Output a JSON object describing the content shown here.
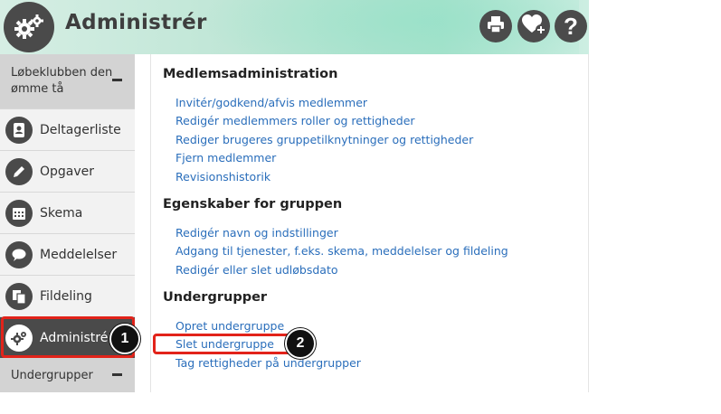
{
  "header": {
    "title": "Administrér",
    "logo_icon": "gears-icon",
    "actions": [
      {
        "icon": "printer-icon"
      },
      {
        "icon": "heart-plus-icon"
      },
      {
        "icon": "help-icon",
        "label": "?"
      }
    ]
  },
  "sidebar": {
    "group_name": "Løbeklubben den\nømme tå",
    "items": [
      {
        "label": "Deltagerliste",
        "icon": "contacts-book-icon"
      },
      {
        "label": "Opgaver",
        "icon": "pencil-icon"
      },
      {
        "label": "Skema",
        "icon": "calendar-icon"
      },
      {
        "label": "Meddelelser",
        "icon": "chat-bubble-icon"
      },
      {
        "label": "Fildeling",
        "icon": "documents-icon"
      },
      {
        "label": "Administrér",
        "icon": "gears-icon",
        "active": true
      }
    ],
    "subgroups_label": "Undergrupper"
  },
  "main": {
    "sections": [
      {
        "title": "Medlemsadministration",
        "links": [
          "Invitér/godkend/afvis medlemmer",
          "Redigér medlemmers roller og rettigheder",
          "Rediger brugeres gruppetilknytninger og rettigheder",
          "Fjern medlemmer",
          "Revisionshistorik"
        ]
      },
      {
        "title": "Egenskaber for gruppen",
        "links": [
          "Redigér navn og indstillinger",
          "Adgang til tjenester, f.eks. skema, meddelelser og fildeling",
          "Redigér eller slet udløbsdato"
        ]
      },
      {
        "title": "Undergrupper",
        "links": [
          "Opret undergruppe",
          "Slet undergruppe",
          "Tag rettigheder på undergrupper"
        ]
      }
    ]
  },
  "annotations": {
    "callout_1": "1",
    "callout_2": "2",
    "highlight_color": "#e2231a"
  },
  "colors": {
    "link": "#2a6ebb",
    "sidebar_active": "#4a4a4a",
    "header_accent": "#a8e2cc"
  }
}
